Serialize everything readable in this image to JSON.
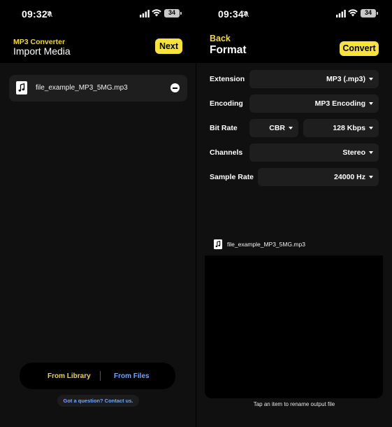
{
  "left_screen": {
    "status": {
      "time": "09:32",
      "battery": "34"
    },
    "header": {
      "subtitle": "MP3 Converter",
      "title": "Import Media",
      "next_label": "Next"
    },
    "files": [
      {
        "name": "file_example_MP3_5MG.mp3"
      }
    ],
    "source_bar": {
      "library_label": "From Library",
      "files_label": "From Files"
    },
    "contact_label": "Got a question? Contact us."
  },
  "right_screen": {
    "status": {
      "time": "09:34",
      "battery": "34"
    },
    "header": {
      "back_label": "Back",
      "title": "Format",
      "convert_label": "Convert"
    },
    "settings": {
      "extension": {
        "label": "Extension",
        "value": "MP3 (.mp3)"
      },
      "encoding": {
        "label": "Encoding",
        "value": "MP3 Encoding"
      },
      "bitrate": {
        "label": "Bit Rate",
        "mode": "CBR",
        "value": "128 Kbps"
      },
      "channels": {
        "label": "Channels",
        "value": "Stereo"
      },
      "samplerate": {
        "label": "Sample Rate",
        "value": "24000 Hz"
      }
    },
    "output_files": [
      {
        "name": "file_example_MP3_5MG.mp3"
      }
    ],
    "hint": "Tap an item to rename output file"
  },
  "colors": {
    "accent": "#f7e33b",
    "link": "#6ea8ff",
    "background": "#000000",
    "card": "#1e1e1e"
  },
  "icons": [
    "bell-slash-icon",
    "signal-icon",
    "wifi-icon",
    "battery-icon",
    "music-file-icon",
    "remove-icon",
    "dropdown-caret-icon"
  ]
}
